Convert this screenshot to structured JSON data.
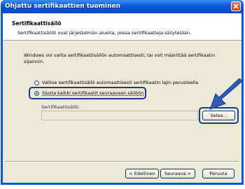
{
  "window": {
    "title": "Ohjattu sertifikaattien tuominen",
    "close_icon": "close-icon"
  },
  "header": {
    "title": "Sertifikaattisäilö",
    "description": "Sertifikaattisäilöt ovat järjestelmän alueita, joissa sertifikaatteja säilytetään."
  },
  "body": {
    "intro": "Windows voi valita sertifikaattisäilön automaattisesti, tai voit määrittää sertifikaatin sijainnin.",
    "option_auto": "Valitse sertifikaattisäilö automaattisesti sertifikaatin lajin perusteella",
    "option_manual": "Sijoita kaikki sertifikaatit seuraavaan säilöön",
    "selected_option": "manual",
    "store_label": "Sertifikaattisäilö:",
    "store_value": "",
    "browse_label": "Selaa..."
  },
  "footer": {
    "back_label": "< Edellinen",
    "next_label": "Seuraava >",
    "cancel_label": "Peruuta"
  },
  "colors": {
    "highlight": "#1f3a8a",
    "arrow": "#2d5bb5",
    "titlebar": "#0a57d8",
    "client_bg": "#ece9d8"
  }
}
